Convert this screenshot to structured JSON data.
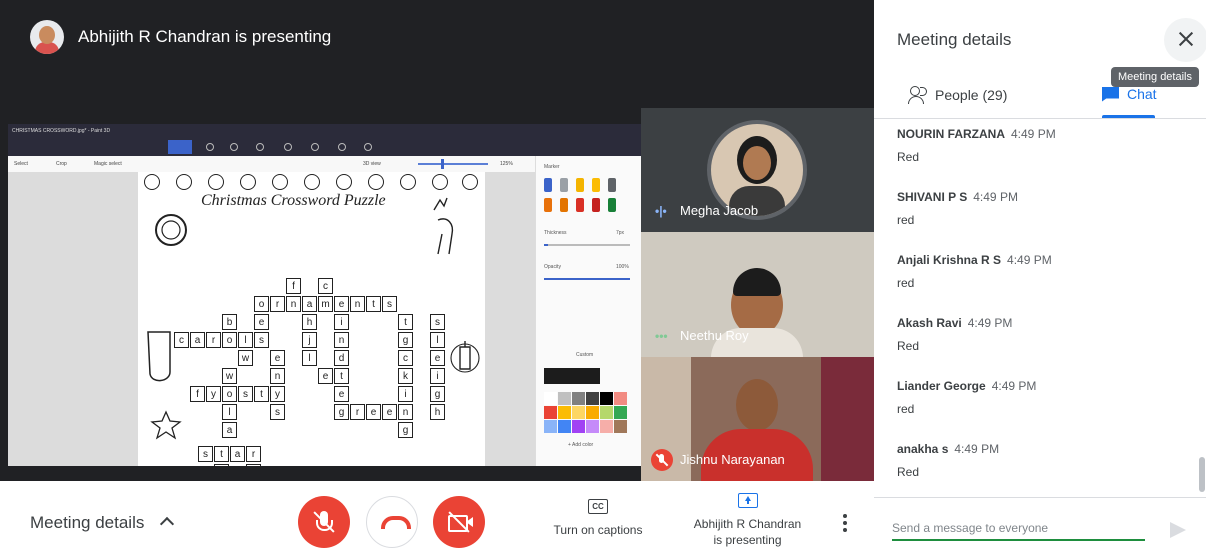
{
  "presenter": {
    "title": "Abhijith R Chandran is presenting"
  },
  "shared_screen": {
    "window_title": "CHRISTMAS CROSSWORD.jpg* - Paint 3D",
    "toolbar": {
      "select": "Select",
      "crop": "Crop",
      "magic_select": "Magic select",
      "view_3d": "3D view",
      "zoom": "125%"
    },
    "puzzle_title": "Christmas Crossword Puzzle",
    "marker_panel": {
      "title": "Marker",
      "thickness_label": "Thickness",
      "thickness_value": "7px",
      "opacity_label": "Opacity",
      "opacity_value": "100%",
      "color_mode": "Custom",
      "add_color": "+ Add color"
    }
  },
  "participants": [
    {
      "name": "Megha Jacob",
      "status": "speaking"
    },
    {
      "name": "Neethu Roy",
      "status": "idle"
    },
    {
      "name": "Jishnu Narayanan",
      "status": "muted"
    }
  ],
  "panel": {
    "title": "Meeting details",
    "tooltip": "Meeting details",
    "tab_people": "People (29)",
    "tab_chat": "Chat",
    "messages": [
      {
        "sender": "NOURIN FARZANA",
        "time": "4:49 PM",
        "text": "Red"
      },
      {
        "sender": "SHIVANI P S",
        "time": "4:49 PM",
        "text": "red"
      },
      {
        "sender": "Anjali Krishna R S",
        "time": "4:49 PM",
        "text": "red"
      },
      {
        "sender": "Akash Ravi",
        "time": "4:49 PM",
        "text": "Red"
      },
      {
        "sender": "Liander George",
        "time": "4:49 PM",
        "text": "red"
      },
      {
        "sender": "anakha s",
        "time": "4:49 PM",
        "text": "Red"
      }
    ],
    "input_placeholder": "Send a message to everyone"
  },
  "bottom_bar": {
    "meeting_details": "Meeting details",
    "captions": "Turn on captions",
    "cc": "CC",
    "presenting_line1": "Abhijith R Chandran",
    "presenting_line2": "is presenting"
  },
  "colors": {
    "accent": "#1a73e8",
    "danger": "#ea4335",
    "dark": "#202124"
  }
}
